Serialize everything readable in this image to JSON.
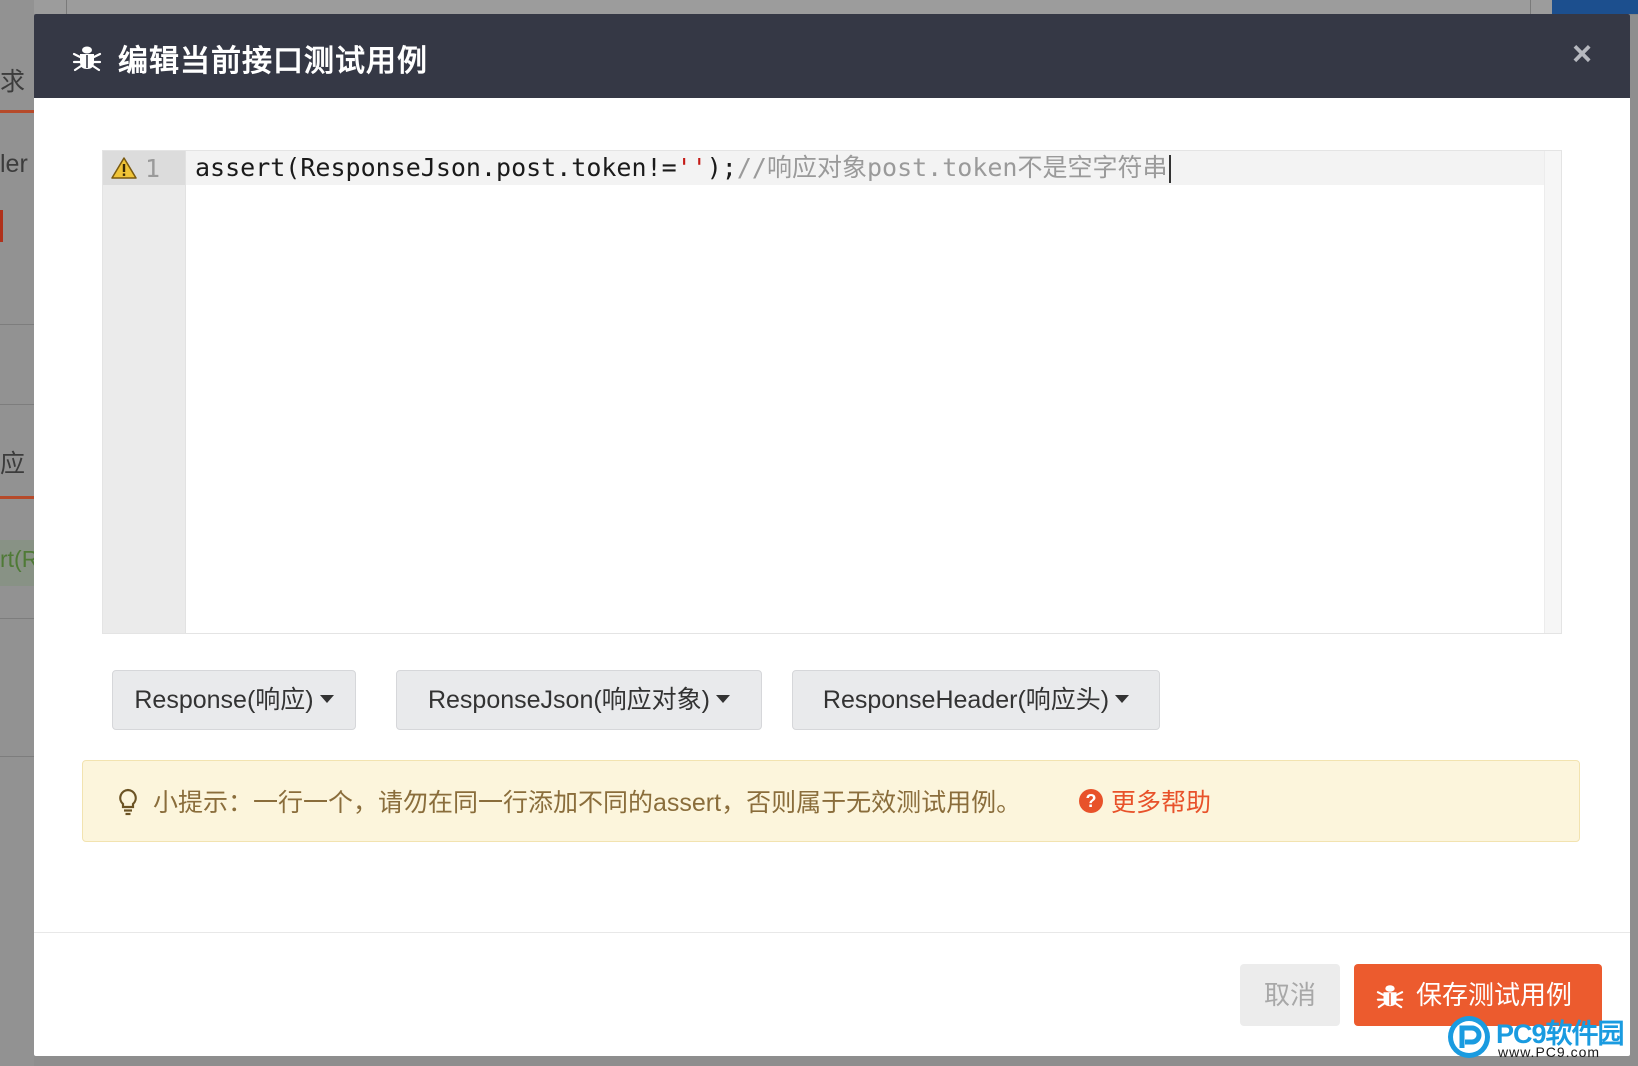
{
  "background": {
    "tab_request_fragment": "求",
    "header_fragment": "ler",
    "tab_response_fragment": "应",
    "code_fragment": "rt(R"
  },
  "modal": {
    "title": "编辑当前接口测试用例",
    "close_label": "×",
    "header_icon": "bug-icon"
  },
  "editor": {
    "line_number": "1",
    "gutter_marker": "warning-icon",
    "code": {
      "prefix": "assert(ResponseJson.post.token!=",
      "string_literal": "''",
      "suffix": ");",
      "comment": "//响应对象post.token不是空字符串"
    }
  },
  "helpers": [
    {
      "label": "Response(响应)"
    },
    {
      "label": "ResponseJson(响应对象)"
    },
    {
      "label": "ResponseHeader(响应头)"
    }
  ],
  "tip": {
    "icon": "lightbulb-icon",
    "text": "小提示：一行一个，请勿在同一行添加不同的assert，否则属于无效测试用例。",
    "help_icon": "question-circle-icon",
    "help_link": "更多帮助"
  },
  "footer": {
    "cancel_label": "取消",
    "save_label": "保存测试用例",
    "save_icon": "bug-icon"
  },
  "watermark": {
    "name": "PC9软件园",
    "url": "www.PC9.com"
  },
  "colors": {
    "header_bg": "#353845",
    "accent": "#ec5b2e",
    "tip_bg": "#fcf5dc",
    "tip_text": "#8a6d3b"
  }
}
